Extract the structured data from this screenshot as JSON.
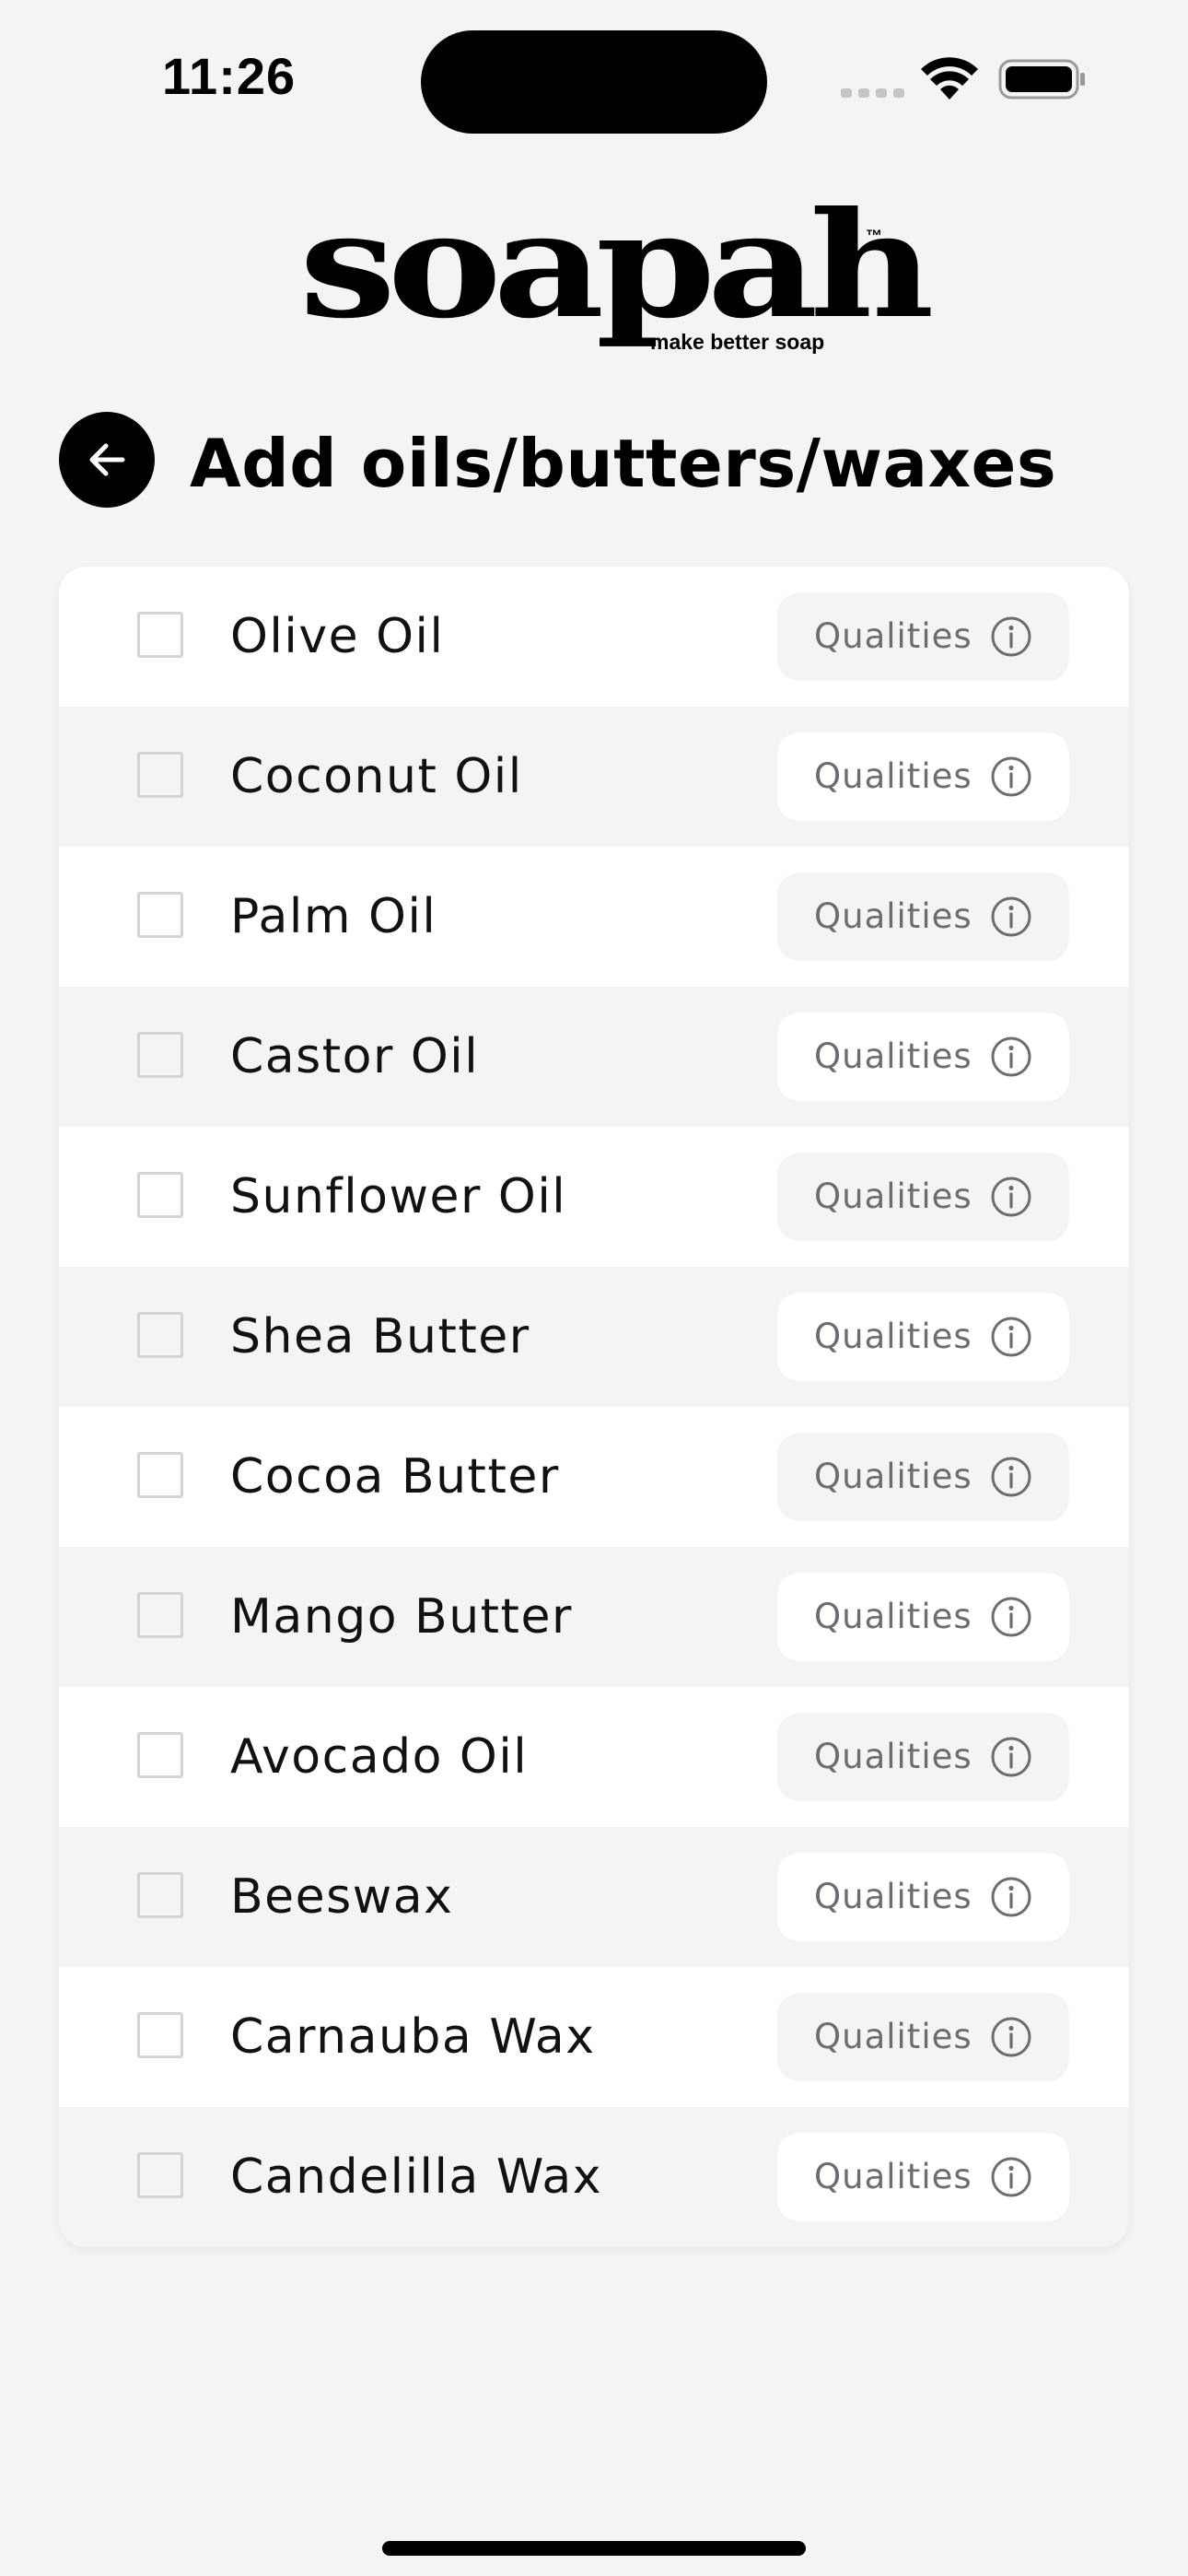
{
  "status_bar": {
    "time": "11:26"
  },
  "logo": {
    "wordmark": "soapah",
    "trademark": "™",
    "tagline": "make better soap"
  },
  "header": {
    "title": "Add oils/butters/waxes"
  },
  "oils": [
    {
      "name": "Olive Oil",
      "qualities_label": "Qualities",
      "checked": false
    },
    {
      "name": "Coconut Oil",
      "qualities_label": "Qualities",
      "checked": false
    },
    {
      "name": "Palm Oil",
      "qualities_label": "Qualities",
      "checked": false
    },
    {
      "name": "Castor Oil",
      "qualities_label": "Qualities",
      "checked": false
    },
    {
      "name": "Sunflower Oil",
      "qualities_label": "Qualities",
      "checked": false
    },
    {
      "name": "Shea Butter",
      "qualities_label": "Qualities",
      "checked": false
    },
    {
      "name": "Cocoa Butter",
      "qualities_label": "Qualities",
      "checked": false
    },
    {
      "name": "Mango Butter",
      "qualities_label": "Qualities",
      "checked": false
    },
    {
      "name": "Avocado Oil",
      "qualities_label": "Qualities",
      "checked": false
    },
    {
      "name": "Beeswax",
      "qualities_label": "Qualities",
      "checked": false
    },
    {
      "name": "Carnauba Wax",
      "qualities_label": "Qualities",
      "checked": false
    },
    {
      "name": "Candelilla Wax",
      "qualities_label": "Qualities",
      "checked": false
    }
  ],
  "icons": {
    "back": "arrow-left-icon",
    "info": "info-circle-icon",
    "wifi": "wifi-icon",
    "battery": "battery-icon",
    "signal": "cellular-signal-icon"
  },
  "colors": {
    "background": "#f5f4f5",
    "row_alt": "#f5f4f5",
    "row": "#ffffff",
    "accent": "#000000",
    "muted_text": "#6e6c72",
    "checkbox_border": "#d5d3d8"
  }
}
